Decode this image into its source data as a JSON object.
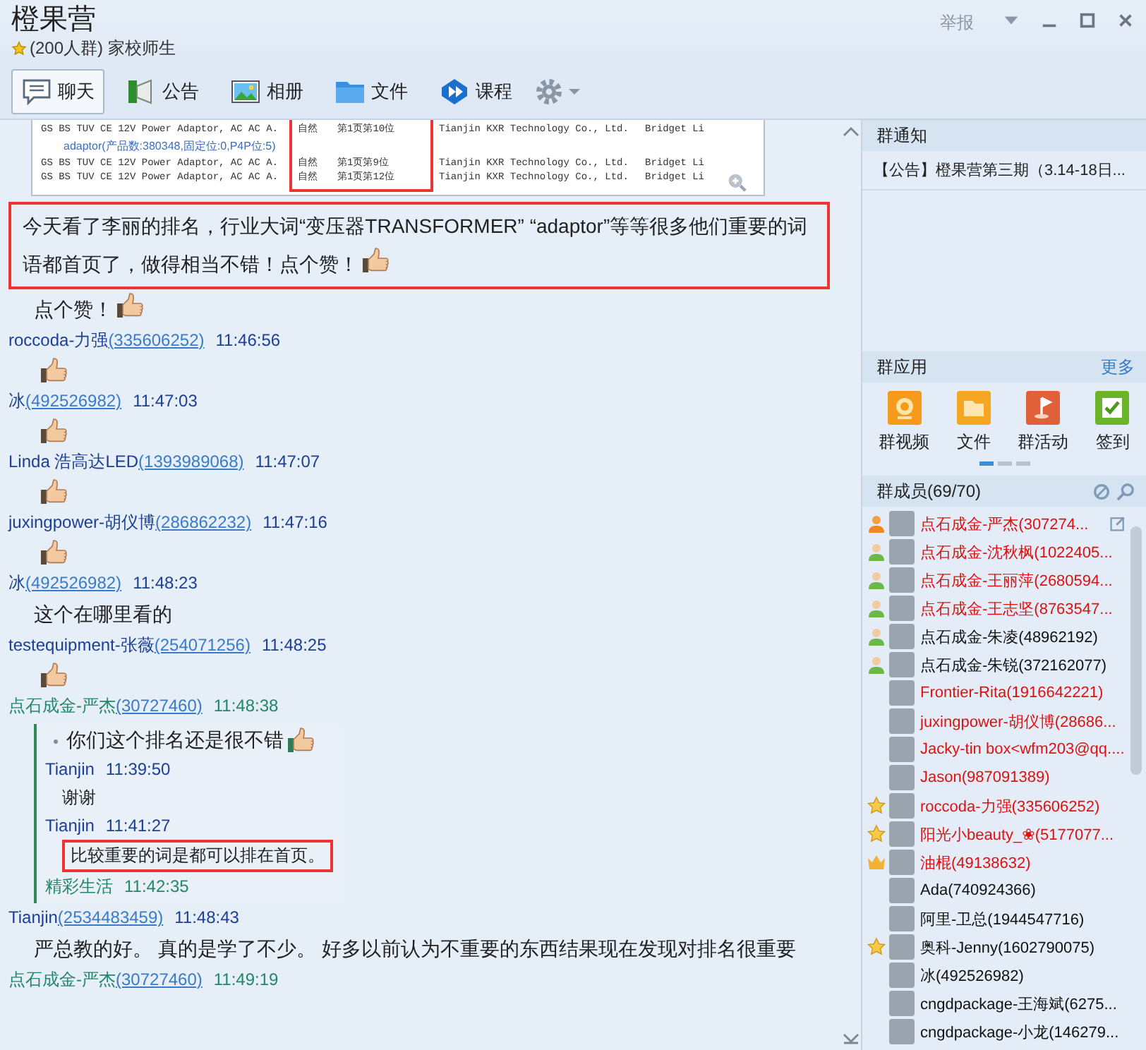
{
  "window": {
    "title": "橙果营",
    "subtitle": "(200人群) 家校师生",
    "report": "举报"
  },
  "tabs": [
    {
      "label": "聊天",
      "kind": "chat",
      "selected": true
    },
    {
      "label": "公告",
      "kind": "notice",
      "selected": false
    },
    {
      "label": "相册",
      "kind": "album",
      "selected": false
    },
    {
      "label": "文件",
      "kind": "file",
      "selected": false
    },
    {
      "label": "课程",
      "kind": "course",
      "selected": false
    }
  ],
  "chat": [
    {
      "kind": "screenshot",
      "marked": true,
      "rows": [
        {
          "kind": "row",
          "cells": [
            "GS BS TUV CE 12V Power Adaptor, AC AC A.",
            "自然",
            "第1页第10位",
            "Tianjin KXR Technology Co., Ltd.",
            "Bridget Li"
          ]
        },
        {
          "kind": "group",
          "text": "adaptor(产品数:380348,固定位:0,P4P位:5)"
        },
        {
          "kind": "row",
          "cells": [
            "GS BS TUV CE 12V Power Adaptor, AC AC A.",
            "自然",
            "第1页第9位",
            "Tianjin KXR Technology Co., Ltd.",
            "Bridget Li"
          ]
        },
        {
          "kind": "row",
          "cells": [
            "GS BS TUV CE 12V Power Adaptor, AC AC A.",
            "自然",
            "第1页第12位",
            "Tianjin KXR Technology Co., Ltd.",
            "Bridget Li"
          ]
        }
      ]
    },
    {
      "kind": "text",
      "text": "今天看了李丽的排名，行业大词“变压器TRANSFORMER” “adaptor”等等很多他们重要的词语都首页了，做得相当不错！点个赞！",
      "thumb": true,
      "highlighted": true
    },
    {
      "kind": "text",
      "text": "点个赞！",
      "thumb": true,
      "highlighted": false
    },
    {
      "kind": "header",
      "name": "roccoda-力强",
      "qq": "(335606252)",
      "time": "11:46:56",
      "color": "#1c3f94"
    },
    {
      "kind": "emoji"
    },
    {
      "kind": "header",
      "name": "冰",
      "qq": "(492526982)",
      "time": "11:47:03",
      "color": "#1c3f94"
    },
    {
      "kind": "emoji"
    },
    {
      "kind": "header",
      "name": "Linda 浩高达LED",
      "qq": "(1393989068)",
      "time": "11:47:07",
      "color": "#1c3f94"
    },
    {
      "kind": "emoji"
    },
    {
      "kind": "header",
      "name": "juxingpower-胡仪博",
      "qq": "(286862232)",
      "time": "11:47:16",
      "color": "#1c3f94"
    },
    {
      "kind": "emoji"
    },
    {
      "kind": "header",
      "name": "冰",
      "qq": "(492526982)",
      "time": "11:48:23",
      "color": "#1c3f94"
    },
    {
      "kind": "text",
      "text": "这个在哪里看的",
      "thumb": false,
      "highlighted": false
    },
    {
      "kind": "header",
      "name": "testequipment-张薇",
      "qq": "(254071256)",
      "time": "11:48:25",
      "color": "#1c3f94"
    },
    {
      "kind": "emoji"
    },
    {
      "kind": "header",
      "name": "点石成金-严杰",
      "qq": "(30727460)",
      "time": "11:48:38",
      "color": "#23866a"
    },
    {
      "kind": "quote",
      "lines": [
        {
          "kind": "text",
          "text": "你们这个排名还是很不错",
          "bullet": true,
          "thumb": true,
          "highlighted": false
        },
        {
          "kind": "header",
          "name": "Tianjin",
          "time": "11:39:50",
          "color": "#1c3f94"
        },
        {
          "kind": "text",
          "text": "谢谢",
          "bullet": false,
          "thumb": false,
          "highlighted": false
        },
        {
          "kind": "header",
          "name": "Tianjin",
          "time": "11:41:27",
          "color": "#1c3f94"
        },
        {
          "kind": "text",
          "text": "比较重要的词是都可以排在首页。",
          "bullet": false,
          "thumb": false,
          "highlighted": true
        },
        {
          "kind": "header",
          "name": "精彩生活",
          "time": "11:42:35",
          "color": "#23866a"
        }
      ]
    },
    {
      "kind": "header",
      "name": "Tianjin",
      "qq": "(2534483459)",
      "time": "11:48:43",
      "color": "#1c3f94"
    },
    {
      "kind": "text",
      "text": "严总教的好。 真的是学了不少。 好多以前认为不重要的东西结果现在发现对排名很重要",
      "thumb": false,
      "highlighted": false
    },
    {
      "kind": "header",
      "name": "点石成金-严杰",
      "qq": "(30727460)",
      "time": "11:49:19",
      "color": "#23866a"
    }
  ],
  "notice": {
    "title": "群通知",
    "text": "【公告】橙果营第三期（3.14-18日..."
  },
  "apps": {
    "title": "群应用",
    "more": "更多",
    "items": [
      {
        "label": "群视频",
        "kind": "video"
      },
      {
        "label": "文件",
        "kind": "file"
      },
      {
        "label": "群活动",
        "kind": "activity"
      },
      {
        "label": "签到",
        "kind": "checkin"
      }
    ]
  },
  "members": {
    "title": "群成员(69/70)",
    "items": [
      {
        "name": "点石成金-严杰(307274...",
        "kind": "owner",
        "color": "#e01010"
      },
      {
        "name": "点石成金-沈秋枫(1022405...",
        "kind": "admin",
        "color": "#e01010"
      },
      {
        "name": "点石成金-王丽萍(2680594...",
        "kind": "admin",
        "color": "#e01010"
      },
      {
        "name": "点石成金-王志坚(8763547...",
        "kind": "admin",
        "color": "#e01010"
      },
      {
        "name": "点石成金-朱凌(48962192)",
        "kind": "admin",
        "color": "#111111"
      },
      {
        "name": "点石成金-朱锐(372162077)",
        "kind": "admin",
        "color": "#111111"
      },
      {
        "name": "Frontier-Rita(1916642221)",
        "kind": "member",
        "color": "#e01010"
      },
      {
        "name": "juxingpower-胡仪博(28686...",
        "kind": "member",
        "color": "#e01010"
      },
      {
        "name": "Jacky-tin box<wfm203@qq....",
        "kind": "member",
        "color": "#e01010"
      },
      {
        "name": "Jason(987091389)",
        "kind": "member",
        "color": "#e01010"
      },
      {
        "name": "roccoda-力强(335606252)",
        "kind": "star",
        "color": "#e01010"
      },
      {
        "name": "阳光小beauty_❀(5177077...",
        "kind": "star",
        "color": "#e01010"
      },
      {
        "name": "油棍(49138632)",
        "kind": "crown",
        "color": "#e01010"
      },
      {
        "name": "Ada(740924366)",
        "kind": "member",
        "color": "#111111"
      },
      {
        "name": "阿里-卫总(1944547716)",
        "kind": "member",
        "color": "#111111"
      },
      {
        "name": "奥科-Jenny(1602790075)",
        "kind": "star",
        "color": "#111111"
      },
      {
        "name": "冰(492526982)",
        "kind": "member",
        "color": "#111111"
      },
      {
        "name": "cngdpackage-王海斌(6275...",
        "kind": "member",
        "color": "#111111"
      },
      {
        "name": "cngdpackage-小龙(146279...",
        "kind": "member",
        "color": "#111111"
      }
    ]
  }
}
